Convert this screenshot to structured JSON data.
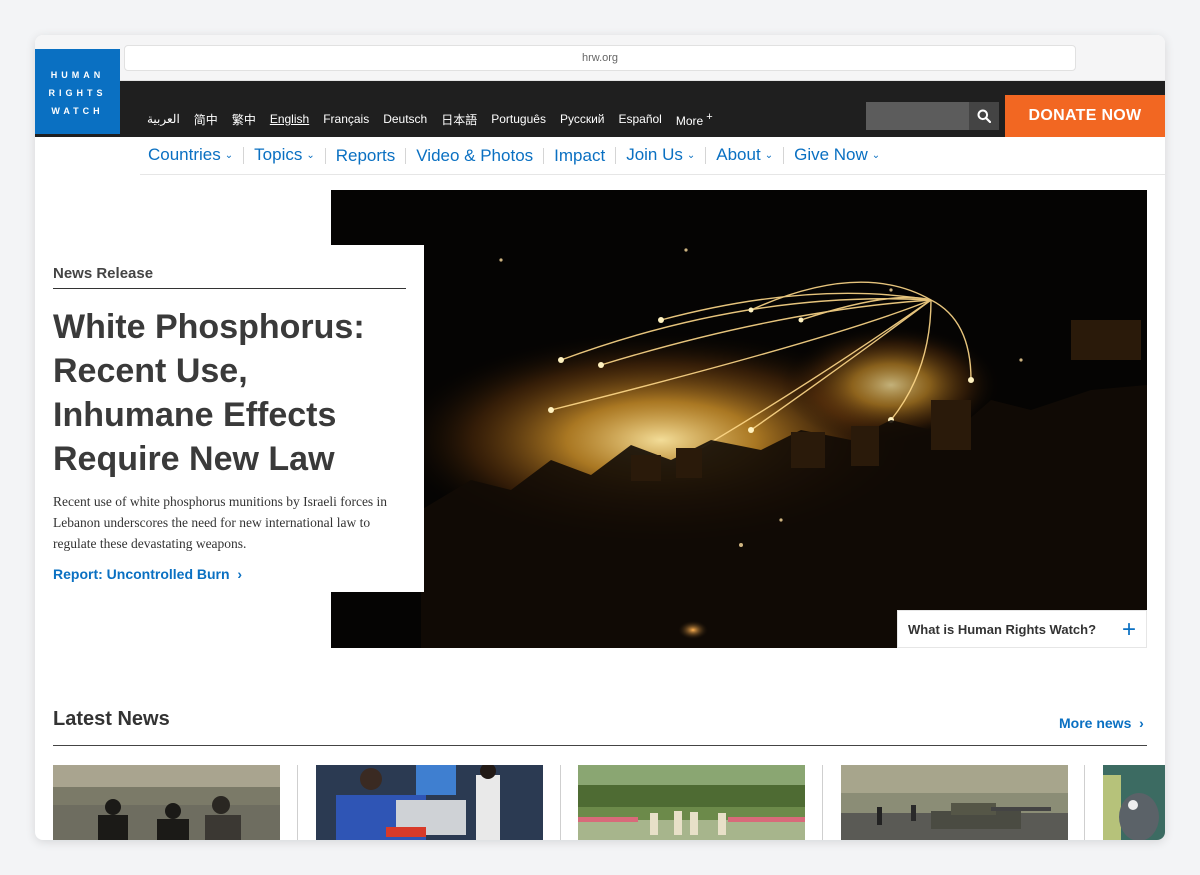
{
  "browser": {
    "url": "hrw.org"
  },
  "logo": {
    "lines": [
      "HUMAN",
      "RIGHTS",
      "WATCH"
    ]
  },
  "languages": [
    "العربية",
    "简中",
    "繁中",
    "English",
    "Français",
    "Deutsch",
    "日本語",
    "Português",
    "Русский",
    "Español",
    "More"
  ],
  "active_language": "English",
  "donate_label": "DONATE NOW",
  "nav": [
    "Countries",
    "Topics",
    "Reports",
    "Video & Photos",
    "Impact",
    "Join Us",
    "About",
    "Give Now"
  ],
  "hero": {
    "eyebrow": "News Release",
    "title": "White Phosphorus: Recent Use, Inhumane Effects Require New Law",
    "summary": "Recent use of white phosphorus munitions by Israeli forces in Lebanon underscores the need for new international law to regulate these devastating weapons.",
    "report_link": "Report: Uncontrolled Burn",
    "whatis": "What is Human Rights Watch?"
  },
  "latest": {
    "title": "Latest News",
    "more_label": "More news"
  },
  "colors": {
    "brand_blue": "#0a70c2",
    "donate_orange": "#f26722",
    "topbar": "#1f1f1f"
  },
  "icons": {
    "search": "search-icon",
    "chevron": "chevron-down-icon",
    "more": "plus-icon",
    "arrow": "chevron-right-icon"
  }
}
